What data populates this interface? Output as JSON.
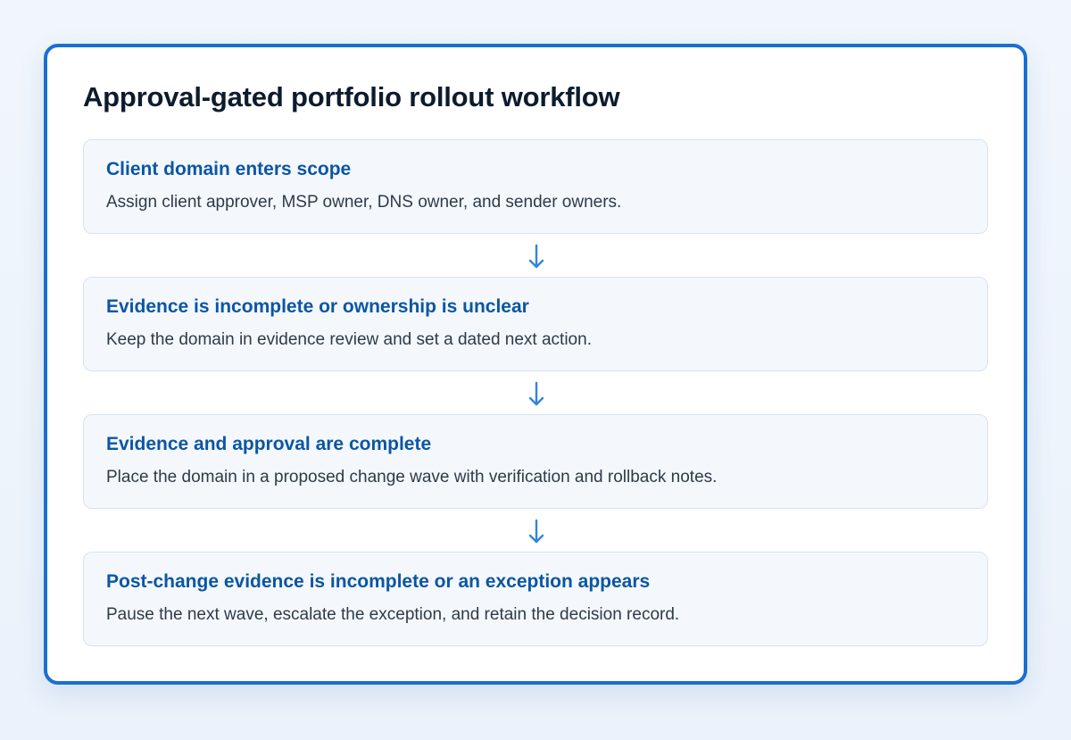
{
  "title": "Approval-gated portfolio rollout workflow",
  "steps": [
    {
      "title": "Client domain enters scope",
      "description": "Assign client approver, MSP owner, DNS owner, and sender owners."
    },
    {
      "title": "Evidence is incomplete or ownership is unclear",
      "description": "Keep the domain in evidence review and set a dated next action."
    },
    {
      "title": "Evidence and approval are complete",
      "description": "Place the domain in a proposed change wave with verification and rollback notes."
    },
    {
      "title": "Post-change evidence is incomplete or an exception appears",
      "description": "Pause the next wave, escalate the exception, and retain the decision record."
    }
  ],
  "colors": {
    "accent": "#1a6fd1",
    "arrow": "#2e86e0",
    "step_title": "#0b56a3",
    "step_background": "#f4f8fd"
  },
  "icons": {
    "connector": "arrow-down-icon"
  }
}
